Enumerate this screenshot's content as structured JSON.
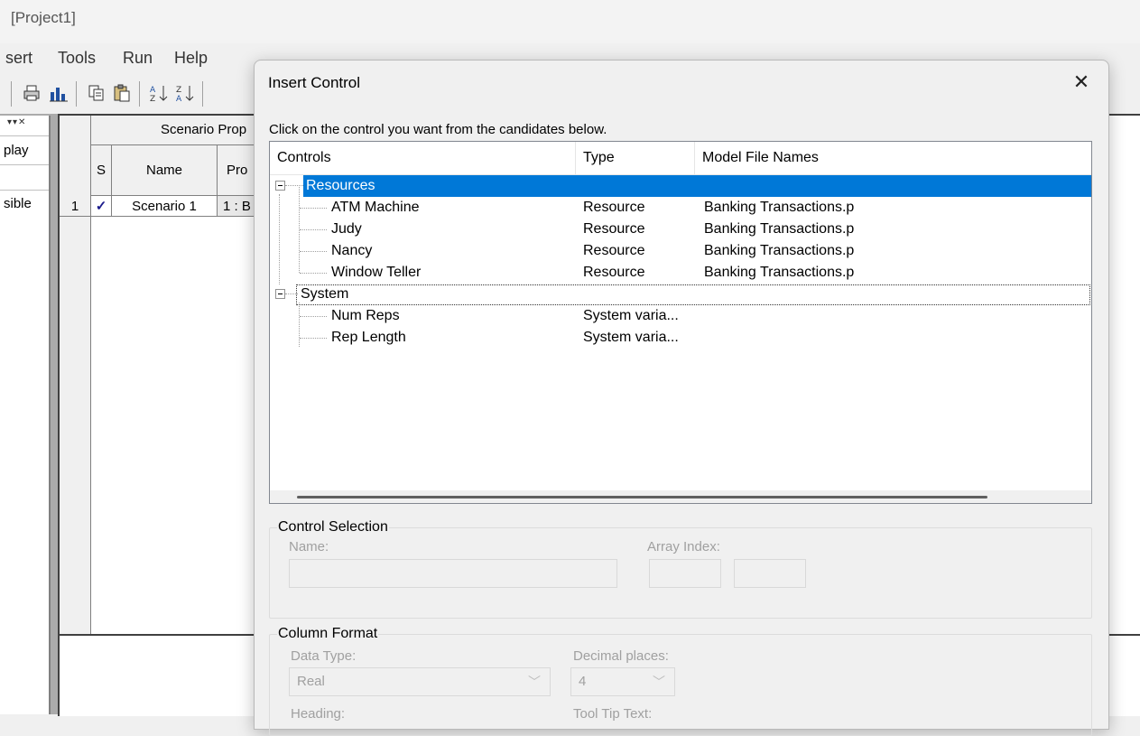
{
  "app": {
    "title": "[Project1]"
  },
  "menu": [
    "sert",
    "Tools",
    "Run",
    "Help"
  ],
  "left_panel": {
    "text1": "play",
    "text2": "sible"
  },
  "grid": {
    "group_header": "Scenario Prop",
    "columns": [
      "S",
      "Name",
      "Pro"
    ],
    "rows": [
      {
        "num": "1",
        "checked": "✓",
        "name": "Scenario 1",
        "program": "1 : B"
      }
    ]
  },
  "dialog": {
    "title": "Insert Control",
    "close_glyph": "✕",
    "instruction": "Click on the control you want from the candidates below.",
    "tree": {
      "columns": [
        "Controls",
        "Type",
        "Model File Names"
      ],
      "groups": [
        {
          "label": "Resources",
          "items": [
            {
              "name": "ATM Machine",
              "type": "Resource",
              "model": "Banking Transactions.p"
            },
            {
              "name": "Judy",
              "type": "Resource",
              "model": "Banking Transactions.p"
            },
            {
              "name": "Nancy",
              "type": "Resource",
              "model": "Banking Transactions.p"
            },
            {
              "name": "Window Teller",
              "type": "Resource",
              "model": "Banking Transactions.p"
            }
          ]
        },
        {
          "label": "System",
          "items": [
            {
              "name": "Num Reps",
              "type": "System varia...",
              "model": ""
            },
            {
              "name": "Rep Length",
              "type": "System varia...",
              "model": ""
            }
          ]
        }
      ]
    },
    "control_selection": {
      "legend": "Control Selection",
      "name_label": "Name:",
      "array_index_label": "Array Index:"
    },
    "column_format": {
      "legend": "Column Format",
      "data_type_label": "Data Type:",
      "data_type_value": "Real",
      "decimal_label": "Decimal places:",
      "decimal_value": "4",
      "heading_label": "Heading:",
      "tooltip_label": "Tool Tip Text:"
    }
  },
  "colors": {
    "selection": "#0078d7",
    "dialog_bg": "#f0f0f0",
    "mdi_bg": "#ababab"
  }
}
